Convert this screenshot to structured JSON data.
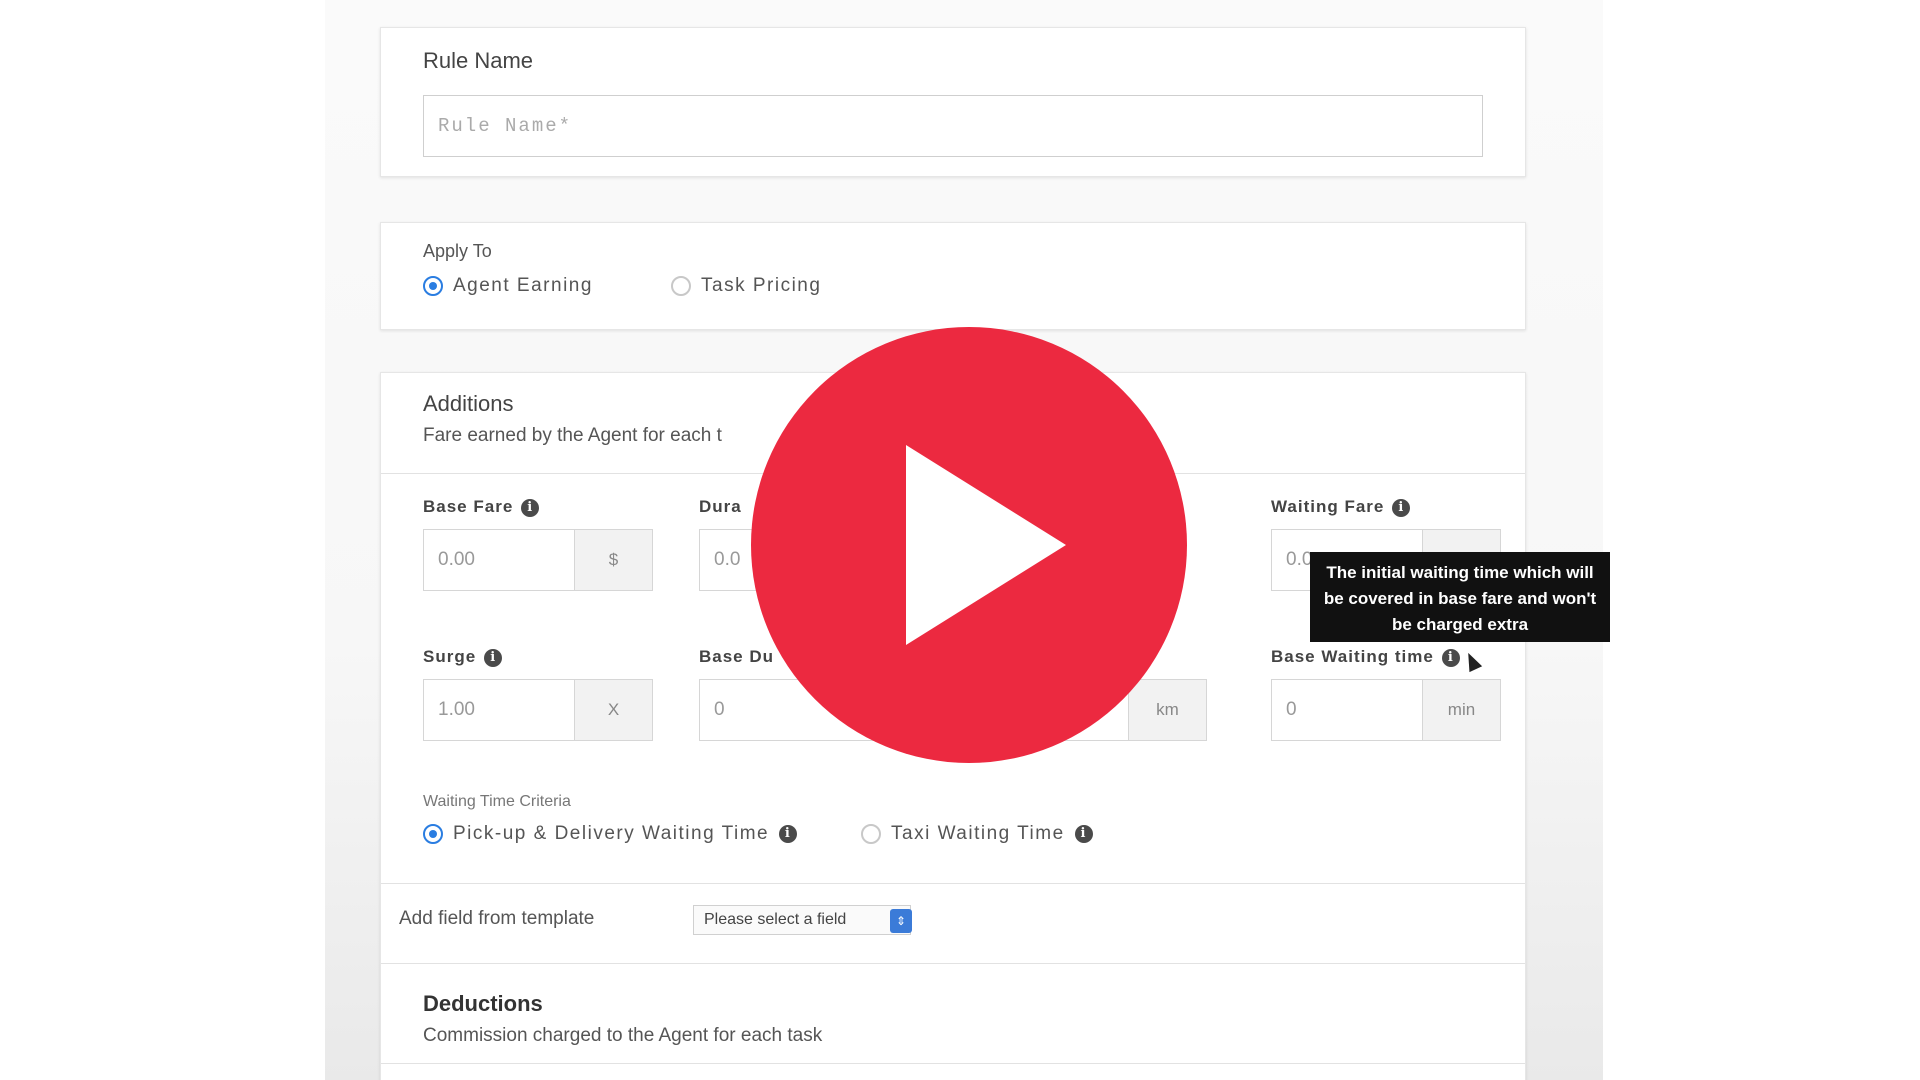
{
  "rule_name": {
    "label": "Rule Name",
    "placeholder": "Rule Name*"
  },
  "apply_to": {
    "label": "Apply To",
    "options": [
      "Agent Earning",
      "Task Pricing"
    ],
    "selected": "Agent Earning"
  },
  "additions": {
    "title": "Additions",
    "subtitle": "Fare earned by the Agent for each t",
    "fields": [
      {
        "label": "Base Fare",
        "value": "0.00",
        "unit": "$"
      },
      {
        "label": "Dura",
        "value": "0.0",
        "unit": ""
      },
      {
        "label": "Waiting Fare",
        "value": "0.0",
        "unit": ""
      },
      {
        "label": "Surge",
        "value": "1.00",
        "unit": "X"
      },
      {
        "label": "Base Du",
        "value": "0",
        "unit": "km"
      },
      {
        "label": "Base Waiting time",
        "value": "0",
        "unit": "min"
      }
    ],
    "waiting_time_criteria": {
      "label": "Waiting Time Criteria",
      "options": [
        "Pick-up & Delivery Waiting Time",
        "Taxi Waiting Time"
      ],
      "selected": "Pick-up & Delivery Waiting Time"
    }
  },
  "template": {
    "label": "Add field from template",
    "select_value": "Please select a field"
  },
  "deductions": {
    "title": "Deductions",
    "subtitle": "Commission charged to the Agent for each task"
  },
  "tooltip": {
    "text": "The initial waiting time which will be covered in base fare and won't be charged extra"
  },
  "icons": {
    "info": "info-icon",
    "play": "play-icon",
    "cursor": "mouse-pointer-icon"
  },
  "colors": {
    "play_button": "#ec2940",
    "radio_selected": "#2a7de1",
    "select_arrow": "#3b7bd8"
  }
}
